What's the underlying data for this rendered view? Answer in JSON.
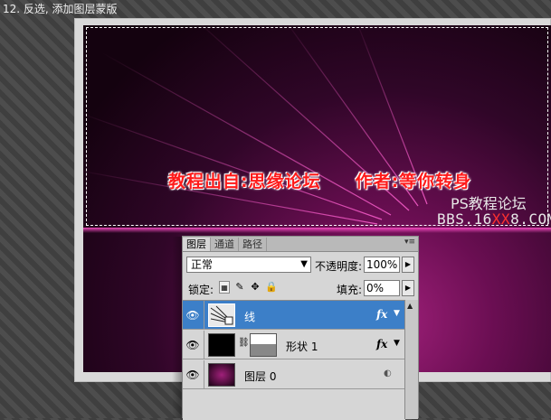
{
  "caption": "12. 反选, 添加图层蒙版",
  "canvas": {
    "credits_left": "教程出自:思缘论坛",
    "credits_right": "作者:等你转身",
    "watermark_line1": "PS教程论坛",
    "watermark_pre": "BBS.16",
    "watermark_red": "XX",
    "watermark_post": "8.COM"
  },
  "panel": {
    "tabs": [
      {
        "label": "图层",
        "active": true
      },
      {
        "label": "通道",
        "active": false
      },
      {
        "label": "路径",
        "active": false
      }
    ],
    "menu_icon": "panel-menu-icon",
    "blend_mode": "正常",
    "opacity_label": "不透明度:",
    "opacity_value": "100%",
    "lock_label": "锁定:",
    "fill_label": "填充:",
    "fill_value": "0%",
    "layers": [
      {
        "name": "线",
        "selected": true,
        "fx": "fx"
      },
      {
        "name": "形状 1",
        "selected": false,
        "fx": "fx"
      },
      {
        "name": "图层 0",
        "selected": false,
        "fx": ""
      }
    ]
  },
  "colors": {
    "credits": "#ff1a1a",
    "selected_layer": "#3c7fc8",
    "canvas_accent": "#a0207a"
  }
}
